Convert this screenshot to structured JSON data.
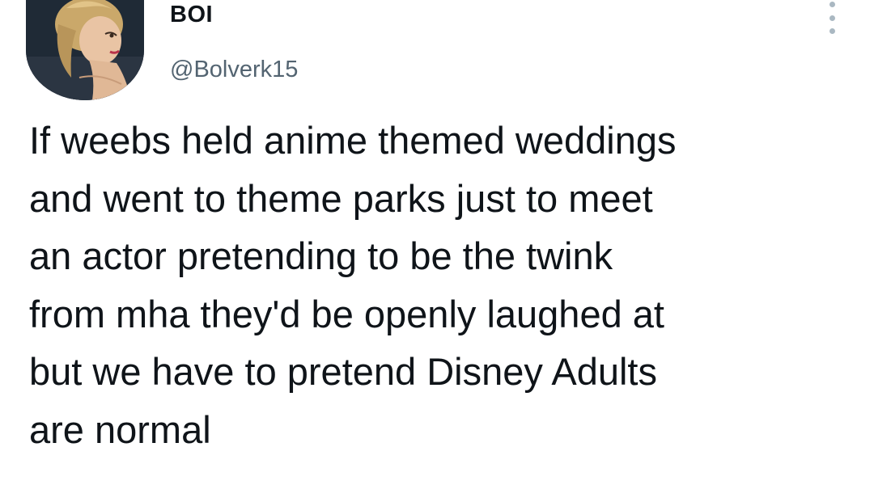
{
  "tweet": {
    "author": {
      "display_name": "BOI",
      "handle": "@Bolverk15",
      "avatar_icon": "profile-avatar-illustration"
    },
    "more_icon": "more-vertical-icon",
    "text": "If weebs held anime themed weddings\nand went to theme parks just to meet\nan actor pretending to be the twink\nfrom mha they'd be openly laughed at\nbut we have to pretend Disney Adults\nare normal"
  },
  "colors": {
    "text_primary": "#0f1419",
    "text_secondary": "#536471",
    "background": "#ffffff"
  }
}
